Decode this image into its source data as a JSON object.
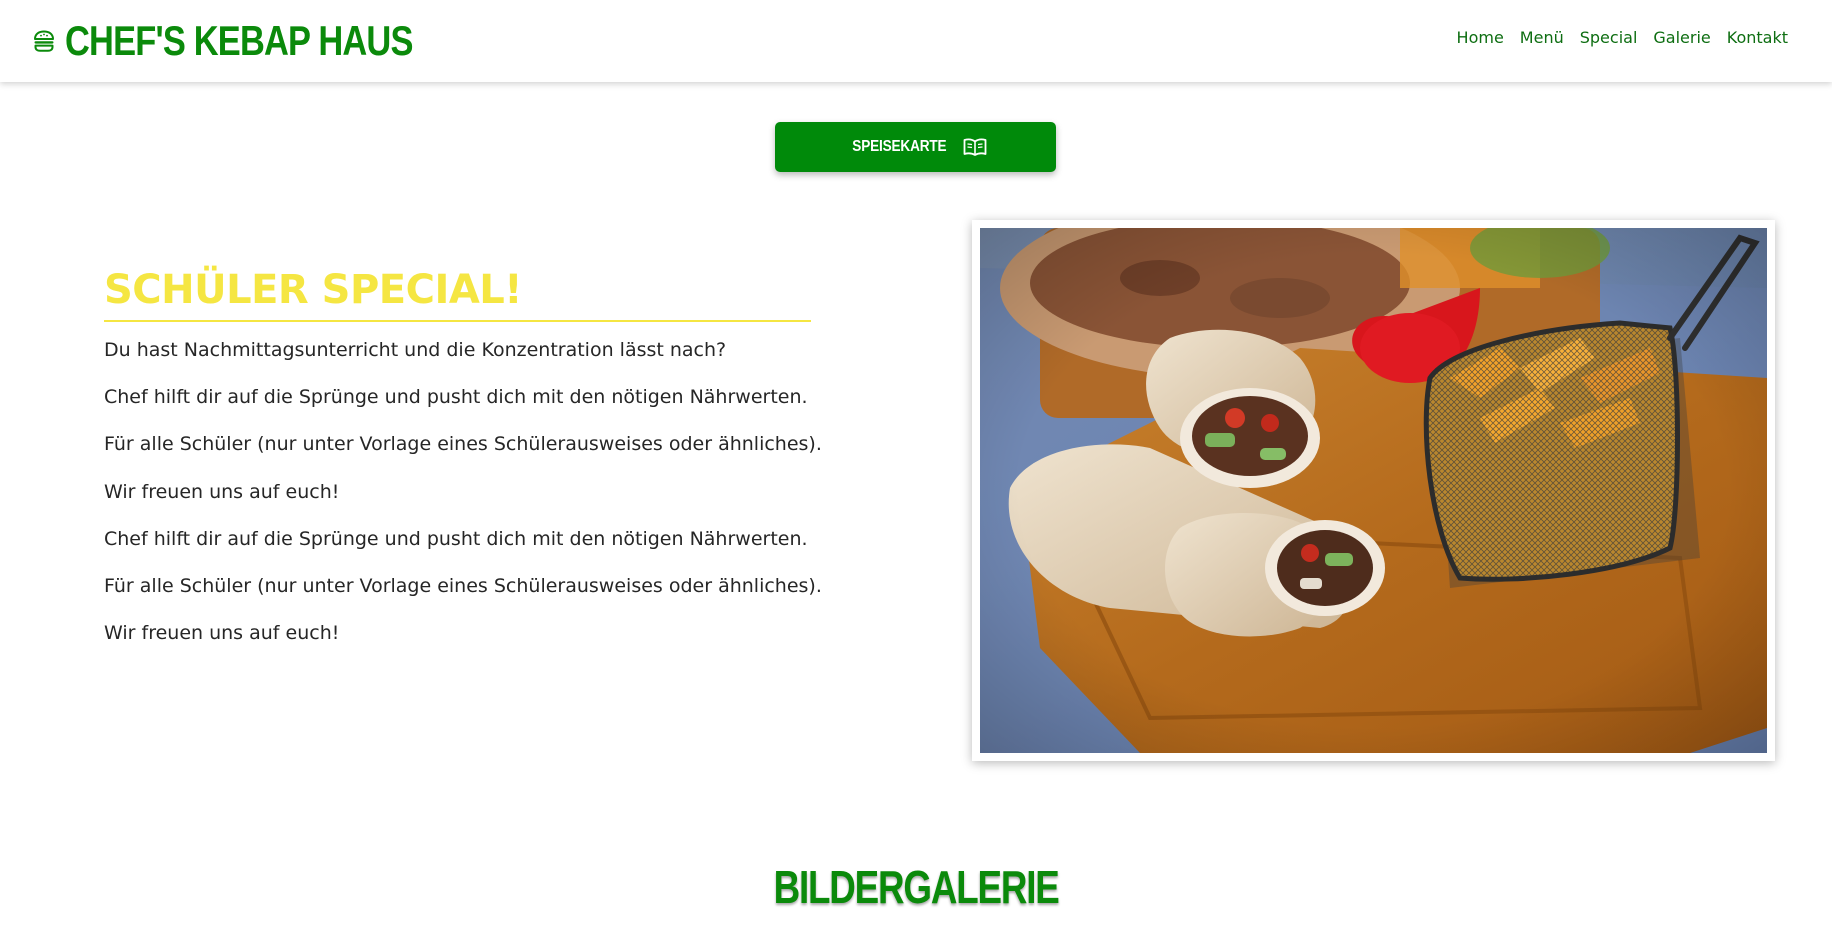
{
  "colors": {
    "brand_green": "#0b8a0b",
    "nav_link": "#0e6e12",
    "button_green": "#008a0a",
    "special_yellow": "#f5e642",
    "body_text": "#262626"
  },
  "header": {
    "logo_icon": "burger-icon",
    "brand": "CHEF'S KEBAP HAUS",
    "nav": [
      "Home",
      "Menü",
      "Special",
      "Galerie",
      "Kontakt"
    ]
  },
  "menu_button": {
    "label": "SPEISEKARTE",
    "icon": "book-open-icon"
  },
  "special": {
    "title": "SCHÜLER SPECIAL!",
    "lines": [
      "Du hast Nachmittagsunterricht und die Konzentration lässt nach?",
      "Chef hilft dir auf die Sprünge und pusht dich mit den nötigen Nährwerten.",
      "Für alle Schüler (nur unter Vorlage eines Schülerausweises oder ähnliches).",
      "Wir freuen uns auf euch!",
      "Chef hilft dir auf die Sprünge und pusht dich mit den nötigen Nährwerten.",
      "Für alle Schüler (nur unter Vorlage eines Schülerausweises oder ähnliches).",
      "Wir freuen uns auf euch!"
    ]
  },
  "gallery": {
    "title": "BILDERGALERIE"
  }
}
